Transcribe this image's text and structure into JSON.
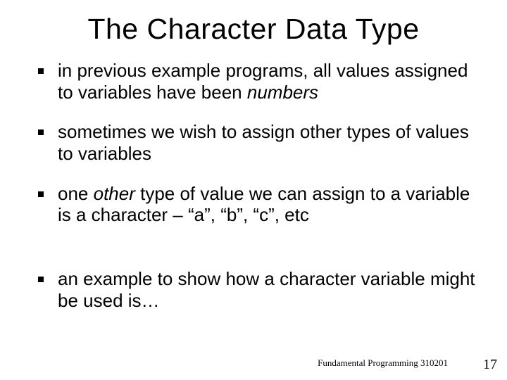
{
  "title": "The Character Data Type",
  "bullets": [
    {
      "prefix": "in previous example programs, all values assigned to variables have been ",
      "italic": "numbers",
      "suffix": ""
    },
    {
      "prefix": "sometimes we wish to assign other types of values to variables",
      "italic": "",
      "suffix": ""
    },
    {
      "prefix": "one ",
      "italic": "other",
      "suffix": " type of value we can assign to a variable is a character – “a”, “b”, “c”, etc"
    },
    {
      "prefix": "an example to show how a character variable might be used is…",
      "italic": "",
      "suffix": ""
    }
  ],
  "footer": {
    "left": "Fundamental Programming 310201",
    "right": "17"
  }
}
